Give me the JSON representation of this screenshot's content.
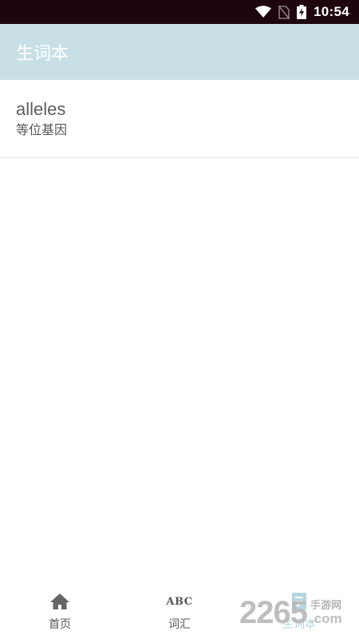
{
  "status_bar": {
    "time": "10:54"
  },
  "app_bar": {
    "title": "生词本"
  },
  "words": [
    {
      "word": "alleles",
      "meaning": "等位基因"
    }
  ],
  "bottom_nav": {
    "items": [
      {
        "label": "首页",
        "icon": "home-icon"
      },
      {
        "label": "词汇",
        "icon": "abc-icon",
        "glyph": "ABC"
      },
      {
        "label": "生词本",
        "icon": "notebook-icon"
      }
    ],
    "active_index": 2
  },
  "watermark": {
    "number": "2265",
    "site_cn": "手游网",
    "site_com": ".com"
  },
  "colors": {
    "status_bar": "#1e0510",
    "app_bar": "#c8e0e5",
    "active_tab": "#b6d6dd",
    "text_gray": "#555555"
  }
}
